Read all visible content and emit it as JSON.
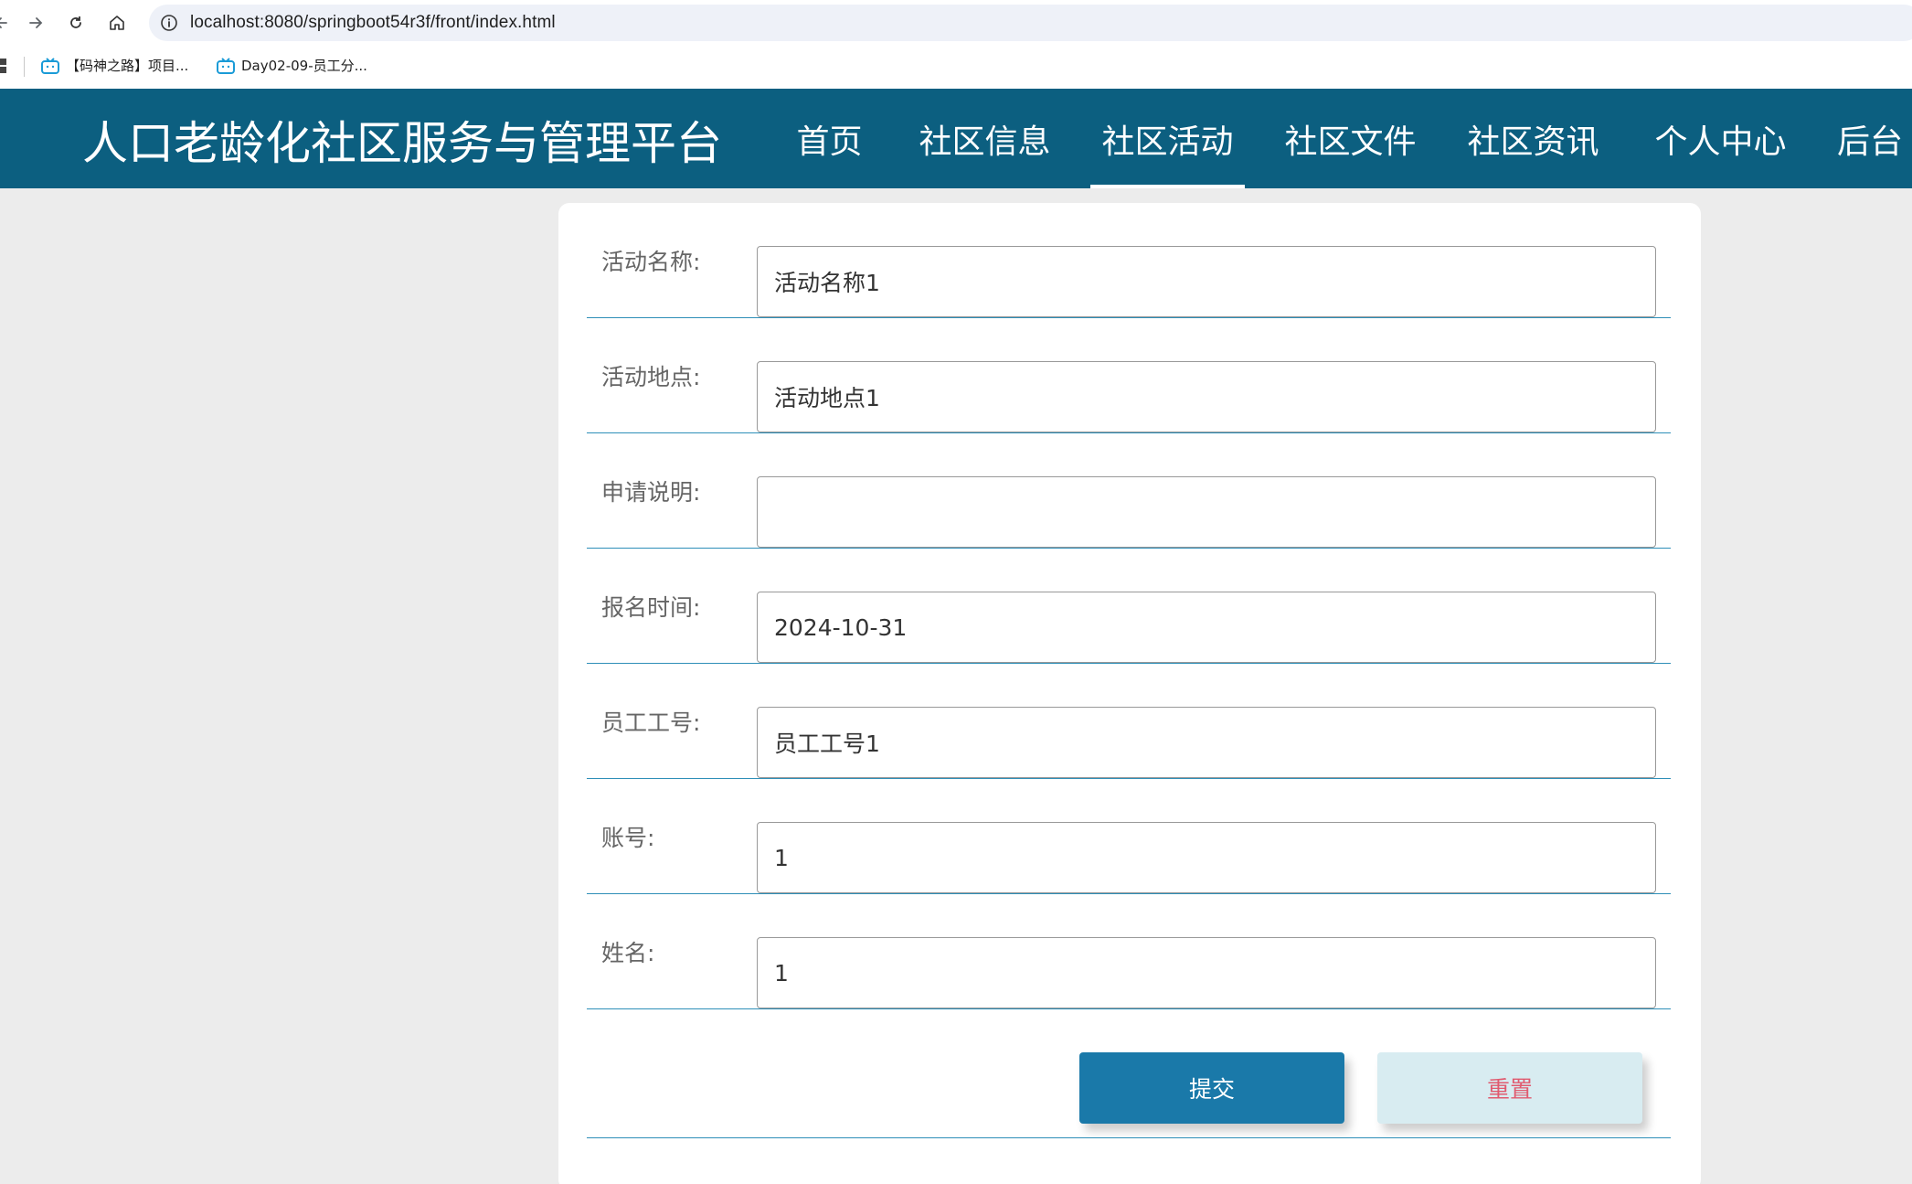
{
  "browser": {
    "url": "localhost:8080/springboot54r3f/front/index.html",
    "bookmarks": [
      "【码神之路】项目...",
      "Day02-09-员工分..."
    ]
  },
  "site": {
    "title": "人口老龄化社区服务与管理平台",
    "nav": [
      "首页",
      "社区信息",
      "社区活动",
      "社区文件",
      "社区资讯",
      "个人中心",
      "后台"
    ],
    "active_nav": "社区活动",
    "colors": {
      "header_bg": "#0c5f80",
      "submit_bg": "#1a79a9",
      "reset_bg": "#d8ecf1",
      "reset_text": "#e05a6f"
    }
  },
  "form": {
    "fields": [
      {
        "label": "活动名称:",
        "value": "活动名称1"
      },
      {
        "label": "活动地点:",
        "value": "活动地点1"
      },
      {
        "label": "申请说明:",
        "value": ""
      },
      {
        "label": "报名时间:",
        "value": "2024-10-31"
      },
      {
        "label": "员工工号:",
        "value": "员工工号1"
      },
      {
        "label": "账号:",
        "value": "1"
      },
      {
        "label": "姓名:",
        "value": "1"
      }
    ],
    "submit_label": "提交",
    "reset_label": "重置"
  }
}
